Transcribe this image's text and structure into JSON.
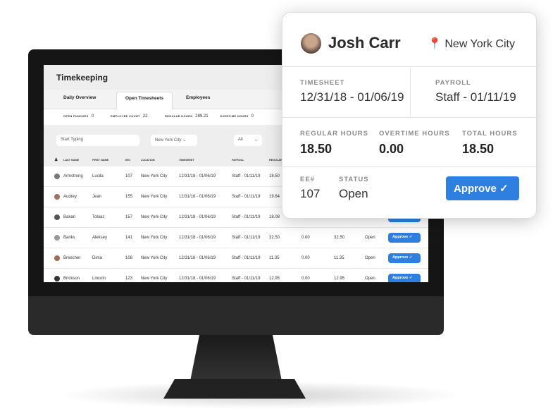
{
  "app": {
    "title": "Timekeeping",
    "tabs": [
      "Daily Overview",
      "Open Timesheets",
      "Employees"
    ],
    "active_tab": "Open Timesheets"
  },
  "stats": [
    {
      "label": "OPEN PUNCHES",
      "value": "0"
    },
    {
      "label": "EMPLOYEE COUNT",
      "value": "22"
    },
    {
      "label": "REGULAR HOURS",
      "value": "289.21"
    },
    {
      "label": "OVERTIME HOURS",
      "value": "0"
    }
  ],
  "filters": {
    "search_placeholder": "Start Typing",
    "location": "New York City",
    "status": "All"
  },
  "columns": [
    "LAST NAME",
    "FIRST NAME",
    "EE#",
    "LOCATION",
    "TIMESHEET",
    "PAYROLL",
    "REGULAR"
  ],
  "rows": [
    {
      "last": "Armstrong",
      "first": "Lucila",
      "ee": "107",
      "location": "New York City",
      "timesheet": "12/31/18 - 01/06/19",
      "payroll": "Staff - 01/11/19",
      "regular": "18.50",
      "overtime": "",
      "total": "",
      "status": "",
      "approve": ""
    },
    {
      "last": "Audrey",
      "first": "Jean",
      "ee": "155",
      "location": "New York City",
      "timesheet": "12/31/18 - 01/06/19",
      "payroll": "Staff - 01/11/19",
      "regular": "19.64",
      "overtime": "",
      "total": "",
      "status": "",
      "approve": ""
    },
    {
      "last": "Bakari",
      "first": "Tobias",
      "ee": "157",
      "location": "New York City",
      "timesheet": "12/31/18 - 01/06/19",
      "payroll": "Staff - 01/11/19",
      "regular": "18.08",
      "overtime": "",
      "total": "",
      "status": "",
      "approve": "Approve"
    },
    {
      "last": "Banks",
      "first": "Aleksey",
      "ee": "141",
      "location": "New York City",
      "timesheet": "12/31/18 - 01/06/19",
      "payroll": "Staff - 01/11/19",
      "regular": "32.50",
      "overtime": "0.00",
      "total": "32.50",
      "status": "Open",
      "approve": "Approve"
    },
    {
      "last": "Breecher",
      "first": "Dima",
      "ee": "108",
      "location": "New York City",
      "timesheet": "12/31/18 - 01/06/19",
      "payroll": "Staff - 01/11/19",
      "regular": "11.35",
      "overtime": "0.00",
      "total": "11.35",
      "status": "Open",
      "approve": "Approve"
    },
    {
      "last": "Brickson",
      "first": "Lincoln",
      "ee": "123",
      "location": "New York City",
      "timesheet": "12/31/18 - 01/06/19",
      "payroll": "Staff - 01/11/19",
      "regular": "12.95",
      "overtime": "0.00",
      "total": "12.95",
      "status": "Open",
      "approve": "Approve"
    }
  ],
  "card": {
    "name": "Josh Carr",
    "location": "New York City",
    "timesheet_label": "TIMESHEET",
    "timesheet": "12/31/18 - 01/06/19",
    "payroll_label": "PAYROLL",
    "payroll": "Staff - 01/11/19",
    "regular_label": "REGULAR HOURS",
    "regular": "18.50",
    "overtime_label": "OVERTIME HOURS",
    "overtime": "0.00",
    "total_label": "TOTAL HOURS",
    "total": "18.50",
    "ee_label": "EE#",
    "ee": "107",
    "status_label": "STATUS",
    "status": "Open",
    "approve": "Approve"
  },
  "colors": {
    "accent": "#2e7fe0",
    "pin": "#f0622f"
  }
}
